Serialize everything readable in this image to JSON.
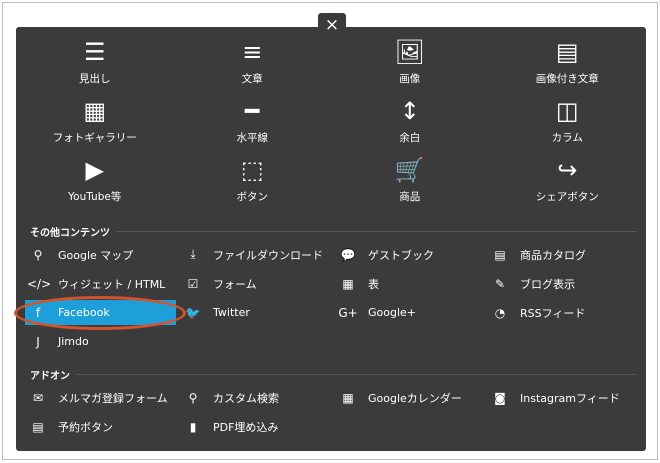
{
  "close_label": "×",
  "blocks": [
    {
      "label": "見出し",
      "icon": "heading-icon",
      "glyph": "☰"
    },
    {
      "label": "文章",
      "icon": "text-icon",
      "glyph": "≡"
    },
    {
      "label": "画像",
      "icon": "image-icon",
      "glyph": "🖼"
    },
    {
      "label": "画像付き文章",
      "icon": "image-text-icon",
      "glyph": "▤"
    },
    {
      "label": "フォトギャラリー",
      "icon": "gallery-icon",
      "glyph": "▦"
    },
    {
      "label": "水平線",
      "icon": "horizontal-line-icon",
      "glyph": "━"
    },
    {
      "label": "余白",
      "icon": "spacing-icon",
      "glyph": "↕"
    },
    {
      "label": "カラム",
      "icon": "columns-icon",
      "glyph": "◫"
    },
    {
      "label": "YouTube等",
      "icon": "play-icon",
      "glyph": "▶"
    },
    {
      "label": "ボタン",
      "icon": "button-cursor-icon",
      "glyph": "⬚"
    },
    {
      "label": "商品",
      "icon": "cart-icon",
      "glyph": "🛒"
    },
    {
      "label": "シェアボタン",
      "icon": "share-icon",
      "glyph": "↪"
    }
  ],
  "other": {
    "title": "その他コンテンツ",
    "items": [
      {
        "label": "Google マップ",
        "icon": "map-pin-icon",
        "glyph": "⚲"
      },
      {
        "label": "ファイルダウンロード",
        "icon": "download-icon",
        "glyph": "⤓"
      },
      {
        "label": "ゲストブック",
        "icon": "chat-bubble-icon",
        "glyph": "💬"
      },
      {
        "label": "商品カタログ",
        "icon": "catalog-icon",
        "glyph": "▤"
      },
      {
        "label": "ウィジェット / HTML",
        "icon": "code-icon",
        "glyph": "</>"
      },
      {
        "label": "フォーム",
        "icon": "checkbox-icon",
        "glyph": "☑"
      },
      {
        "label": "表",
        "icon": "table-icon",
        "glyph": "▦"
      },
      {
        "label": "ブログ表示",
        "icon": "edit-icon",
        "glyph": "✎"
      },
      {
        "label": "Facebook",
        "icon": "facebook-icon",
        "glyph": "f"
      },
      {
        "label": "Twitter",
        "icon": "twitter-icon",
        "glyph": "🐦"
      },
      {
        "label": "Google+",
        "icon": "google-plus-icon",
        "glyph": "G+"
      },
      {
        "label": "RSSフィード",
        "icon": "rss-icon",
        "glyph": "◔"
      },
      {
        "label": "Jimdo",
        "icon": "jimdo-icon",
        "glyph": "J"
      }
    ]
  },
  "addons": {
    "title": "アドオン",
    "items": [
      {
        "label": "メルマガ登録フォーム",
        "icon": "mail-icon",
        "glyph": "✉"
      },
      {
        "label": "カスタム検索",
        "icon": "search-icon",
        "glyph": "⚲"
      },
      {
        "label": "Googleカレンダー",
        "icon": "calendar-icon",
        "glyph": "▦"
      },
      {
        "label": "Instagramフィード",
        "icon": "instagram-icon",
        "glyph": "◙"
      },
      {
        "label": "予約ボタン",
        "icon": "book-icon",
        "glyph": "▤"
      },
      {
        "label": "PDF埋め込み",
        "icon": "pdf-icon",
        "glyph": "▮"
      }
    ]
  },
  "colors": {
    "panel": "#3b3b3b",
    "highlight": "#1f9fd9",
    "annotation": "#d5532b"
  }
}
